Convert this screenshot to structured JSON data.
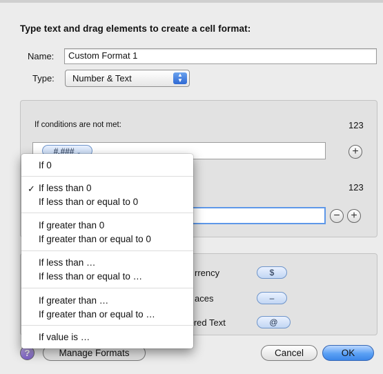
{
  "title": "Type text and drag elements to create a cell format:",
  "name_label": "Name:",
  "name_value": "Custom Format 1",
  "type_label": "Type:",
  "type_value": "Number & Text",
  "conditions_label": "If conditions are not met:",
  "preview_top": "123",
  "preview_mid": "123",
  "format_token": "#.###",
  "elements": [
    {
      "label": "rrency",
      "token": "$"
    },
    {
      "label": "aces",
      "token": "–"
    },
    {
      "label": "tered Text",
      "token": "@"
    }
  ],
  "menu": {
    "selected_marker": "✓",
    "items": [
      "If 0",
      "If less than 0",
      "If less than or equal to 0",
      "If greater than 0",
      "If greater than or equal to 0",
      "If less than …",
      "If less than or equal to …",
      "If greater than …",
      "If greater than or equal to …",
      "If value is …"
    ]
  },
  "footer": {
    "help_glyph": "?",
    "manage_formats": "Manage Formats",
    "cancel": "Cancel",
    "ok": "OK"
  }
}
